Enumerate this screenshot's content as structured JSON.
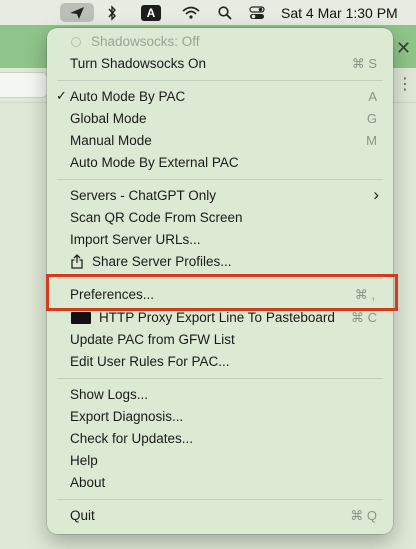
{
  "menubar": {
    "input_badge": "A",
    "clock": "Sat 4 Mar  1:30 PM",
    "icons": [
      "shadowsocks-icon",
      "bluetooth-icon",
      "input-source-icon",
      "wifi-icon",
      "search-icon",
      "control-center-icon"
    ]
  },
  "menu": {
    "status": "Shadowsocks: Off",
    "toggle": {
      "label": "Turn Shadowsocks On",
      "shortcut": "⌘ S"
    },
    "modes": [
      {
        "label": "Auto Mode By PAC",
        "shortcut": "A",
        "checked": true,
        "check": "✓"
      },
      {
        "label": "Global Mode",
        "shortcut": "G"
      },
      {
        "label": "Manual Mode",
        "shortcut": "M"
      },
      {
        "label": "Auto Mode By External PAC",
        "shortcut": ""
      }
    ],
    "servers": {
      "label": "Servers - ChatGPT Only",
      "arrow": "›",
      "scan_qr": "Scan QR Code From Screen",
      "import_urls": "Import Server URLs...",
      "share_profiles": "Share Server Profiles..."
    },
    "preferences": {
      "label": "Preferences...",
      "shortcut": "⌘ ,"
    },
    "http_proxy": {
      "label": "HTTP Proxy Export Line To Pasteboard",
      "shortcut": "⌘ C"
    },
    "update_pac": "Update PAC from GFW List",
    "edit_rules": "Edit User Rules For PAC...",
    "show_logs": "Show Logs...",
    "export_diag": "Export Diagnosis...",
    "check_updates": "Check for Updates...",
    "help": "Help",
    "about": "About",
    "quit": {
      "label": "Quit",
      "shortcut": "⌘ Q"
    }
  },
  "background": {
    "close_glyph": "✕",
    "more_glyph": "⋮"
  },
  "colors": {
    "highlight": "#d43b1c",
    "menu_bg": "#dcead3",
    "header_green": "#8fc48a"
  }
}
